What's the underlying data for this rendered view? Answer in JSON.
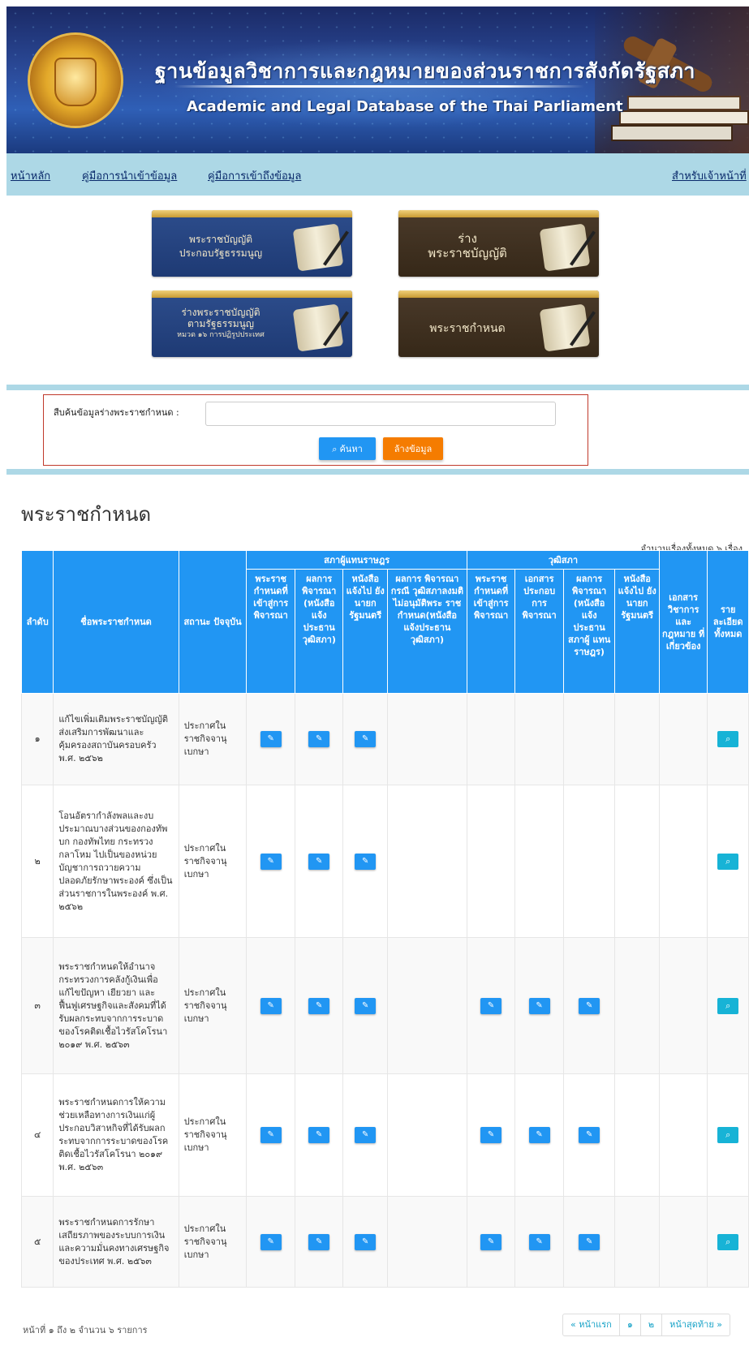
{
  "banner": {
    "title_th": "ฐานข้อมูลวิชาการและกฎหมายของส่วนราชการสังกัดรัฐสภา",
    "title_en": "Academic and Legal Database of the Thai Parliament"
  },
  "nav": {
    "home": "หน้าหลัก",
    "input_guide": "คู่มือการนำเข้าข้อมูล",
    "access_guide": "คู่มือการเข้าถึงข้อมูล",
    "staff": "สำหรับเจ้าหน้าที่"
  },
  "tiles": [
    {
      "line1": "พระราชบัญญัติ",
      "line2": "ประกอบรัฐธรรมนูญ",
      "line3": ""
    },
    {
      "line1": "ร่าง",
      "line2": "พระราชบัญญัติ",
      "line3": ""
    },
    {
      "line1": "ร่างพระราชบัญญัติ",
      "line2": "ตามรัฐธรรมนูญ",
      "line3": "หมวด ๑๖ การปฏิรูปประเทศ"
    },
    {
      "line1": "พระราชกำหนด",
      "line2": "",
      "line3": ""
    }
  ],
  "search": {
    "label": "สืบค้นข้อมูลร่างพระราชกำหนด :",
    "value": "",
    "search_button": "ค้นหา",
    "clear_button": "ล้างข้อมูล"
  },
  "page_title": "พระราชกำหนด",
  "total_text": "จำนวนเรื่องทั้งหมด ๖ เรื่อง",
  "table": {
    "group_house": "สภาผู้แทนราษฎร",
    "group_senate": "วุฒิสภา",
    "col_no": "ลำดับ",
    "col_name": "ชื่อพระราชกำหนด",
    "col_status": "สถานะ ปัจจุบัน",
    "house_cols": [
      "พระราช กำหนดที่ เข้าสู่การ พิจารณา",
      "ผลการ พิจารณา (หนังสือ แจ้ง ประธาน วุฒิสภา)",
      "หนังสือ แจ้งไป ยัง นายก รัฐมนตรี",
      "ผลการ พิจารณากรณี วุฒิสภาลงมติ ไม่อนุมัติพระ ราช กำหนด(หนังสือ แจ้งประธาน วุฒิสภา)"
    ],
    "senate_cols": [
      "พระราช กำหนดที่ เข้าสู่การ พิจารณา",
      "เอกสาร ประกอบ การ พิจารณา",
      "ผลการ พิจารณา (หนังสือ แจ้ง ประธาน สภาผู้ แทน ราษฎร)",
      "หนังสือ แจ้งไป ยัง นายก รัฐมนตรี"
    ],
    "col_docs": "เอกสาร วิชาการ และ กฎหมาย ที่ เกี่ยวข้อง",
    "col_detail": "ราย ละเอียด ทั้งหมด",
    "rows": [
      {
        "no": "๑",
        "name": "แก้ไขเพิ่มเติมพระราชบัญญัติส่งเสริมการพัฒนาและคุ้มครองสถาบันครอบครัว พ.ศ. ๒๕๖๒",
        "status": "ประกาศในราชกิจจานุเบกษา",
        "icons": [
          1,
          1,
          1,
          0,
          0,
          0,
          0,
          0,
          0
        ]
      },
      {
        "no": "๒",
        "name": "โอนอัตรากำลังพลและงบประมาณบางส่วนของกองทัพบก กองทัพไทย กระทรวงกลาโหม ไปเป็นของหน่วยบัญชาการถวายความปลอดภัยรักษาพระองค์ ซึ่งเป็นส่วนราชการในพระองค์ พ.ศ. ๒๕๖๒",
        "status": "ประกาศในราชกิจจานุเบกษา",
        "icons": [
          1,
          1,
          1,
          0,
          0,
          0,
          0,
          0,
          0
        ]
      },
      {
        "no": "๓",
        "name": "พระราชกำหนดให้อำนาจกระทรวงการคลังกู้เงินเพื่อแก้ไขปัญหา เยียวยา และฟื้นฟูเศรษฐกิจและสังคมที่ได้รับผลกระทบจากการระบาดของโรคติดเชื้อไวรัสโคโรนา ๒๐๑๙ พ.ศ. ๒๕๖๓",
        "status": "ประกาศในราชกิจจานุเบกษา",
        "icons": [
          1,
          1,
          1,
          0,
          1,
          1,
          1,
          0,
          0
        ]
      },
      {
        "no": "๔",
        "name": "พระราชกำหนดการให้ความช่วยเหลือทางการเงินแก่ผู้ประกอบวิสาหกิจที่ได้รับผลกระทบจากการระบาดของโรคติดเชื้อไวรัสโคโรนา ๒๐๑๙ พ.ศ. ๒๕๖๓",
        "status": "ประกาศในราชกิจจานุเบกษา",
        "icons": [
          1,
          1,
          1,
          0,
          1,
          1,
          1,
          0,
          0
        ]
      },
      {
        "no": "๕",
        "name": "พระราชกำหนดการรักษาเสถียรภาพของระบบการเงินและความมั่นคงทางเศรษฐกิจของประเทศ พ.ศ. ๒๕๖๓",
        "status": "ประกาศในราชกิจจานุเบกษา",
        "icons": [
          1,
          1,
          1,
          0,
          1,
          1,
          1,
          0,
          0
        ]
      }
    ]
  },
  "footer": {
    "info": "หน้าที่ ๑ ถึง ๒ จำนวน ๖ รายการ",
    "first": "« หน้าแรก",
    "page1": "๑",
    "page2": "๒",
    "last": "หน้าสุดท้าย »"
  },
  "colors": {
    "primary": "#2196f3",
    "accent": "#f57c00",
    "nav_bg": "#add8e6",
    "detail_btn": "#17b3d6"
  }
}
